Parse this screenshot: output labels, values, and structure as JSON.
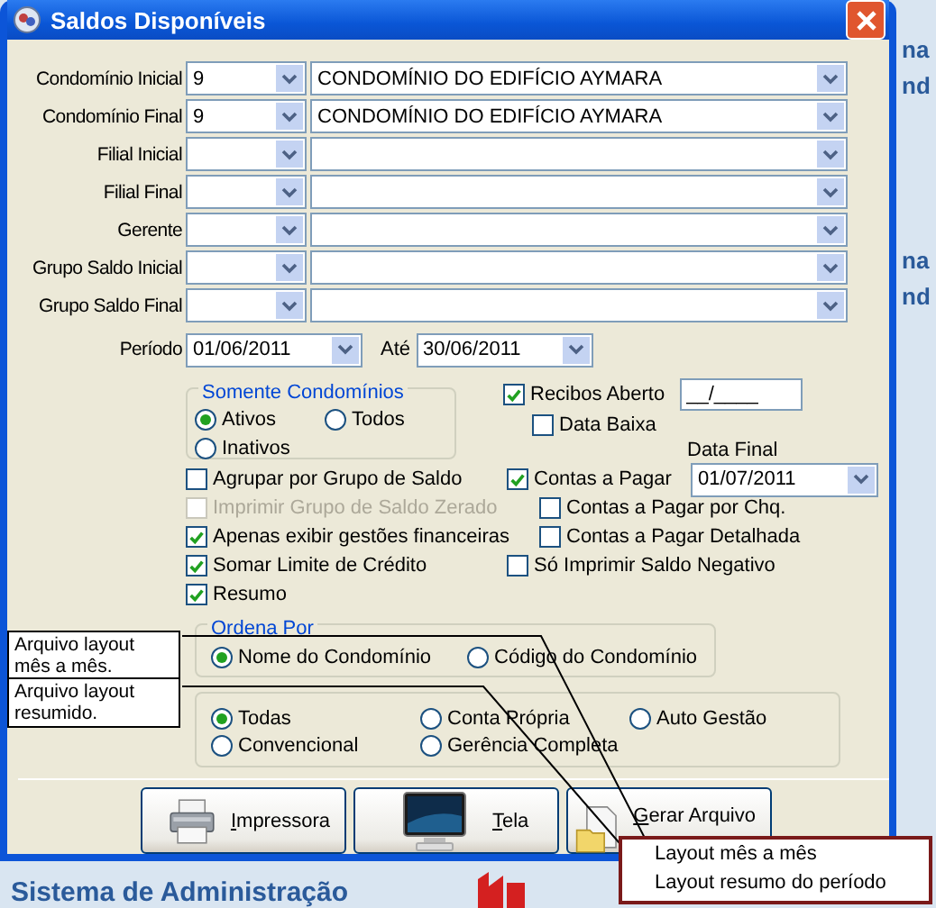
{
  "window": {
    "title": "Saldos Disponíveis"
  },
  "filters": [
    {
      "label": "Condomínio Inicial",
      "code": "9",
      "name": "CONDOMÍNIO DO EDIFÍCIO AYMARA"
    },
    {
      "label": "Condomínio Final",
      "code": "9",
      "name": "CONDOMÍNIO DO EDIFÍCIO AYMARA"
    },
    {
      "label": "Filial Inicial"
    },
    {
      "label": "Filial Final"
    },
    {
      "label": "Gerente"
    },
    {
      "label": "Grupo Saldo Inicial"
    },
    {
      "label": "Grupo Saldo Final"
    }
  ],
  "period": {
    "label": "Período",
    "from": "01/06/2011",
    "to_label": "Até",
    "to": "30/06/2011"
  },
  "somente_condominios": {
    "title": "Somente Condomínios",
    "options": [
      {
        "label": "Ativos",
        "selected": true
      },
      {
        "label": "Todos",
        "selected": false
      },
      {
        "label": "Inativos",
        "selected": false
      }
    ]
  },
  "recibos_aberto": {
    "label": "Recibos Aberto",
    "checked": true,
    "value": "__/____"
  },
  "data_baixa": {
    "label": "Data Baixa",
    "checked": false
  },
  "data_final": {
    "label": "Data Final",
    "value": "01/07/2011"
  },
  "options_left": [
    {
      "label": "Agrupar por Grupo de Saldo",
      "checked": false,
      "disabled": false
    },
    {
      "label": "Imprimir Grupo de Saldo Zerado",
      "checked": false,
      "disabled": true
    },
    {
      "label": "Apenas exibir gestões financeiras",
      "checked": true,
      "disabled": false
    },
    {
      "label": "Somar Limite de Crédito",
      "checked": true,
      "disabled": false
    },
    {
      "label": "Resumo",
      "checked": true,
      "disabled": false
    }
  ],
  "options_right": [
    {
      "label": "Contas a Pagar",
      "checked": true
    },
    {
      "label": "Contas a Pagar por Chq.",
      "checked": false
    },
    {
      "label": "Contas a Pagar Detalhada",
      "checked": false
    },
    {
      "label": "Só Imprimir Saldo Negativo",
      "checked": false
    }
  ],
  "ordena_por": {
    "title": "Ordena Por",
    "options": [
      {
        "label": "Nome do Condomínio",
        "selected": true
      },
      {
        "label": "Código do Condomínio",
        "selected": false
      }
    ]
  },
  "gestao": {
    "options": [
      {
        "label": "Todas",
        "selected": true
      },
      {
        "label": "Conta Própria",
        "selected": false
      },
      {
        "label": "Auto Gestão",
        "selected": false
      },
      {
        "label": "Convencional",
        "selected": false
      },
      {
        "label": "Gerência Completa",
        "selected": false
      }
    ]
  },
  "buttons": [
    {
      "label": "Impressora",
      "kind": "printer"
    },
    {
      "label": "Tela",
      "kind": "monitor"
    },
    {
      "label": "Gerar Arquivo",
      "kind": "file"
    }
  ],
  "popup_menu": {
    "items": [
      "Layout mês a mês",
      "Layout resumo do período"
    ]
  },
  "callouts": [
    "Arquivo layout mês a mês.",
    "Arquivo layout resumido."
  ],
  "background": {
    "side_texts": [
      "na",
      "nd",
      "na",
      "nd"
    ],
    "footer_title": "Sistema de Administração"
  }
}
